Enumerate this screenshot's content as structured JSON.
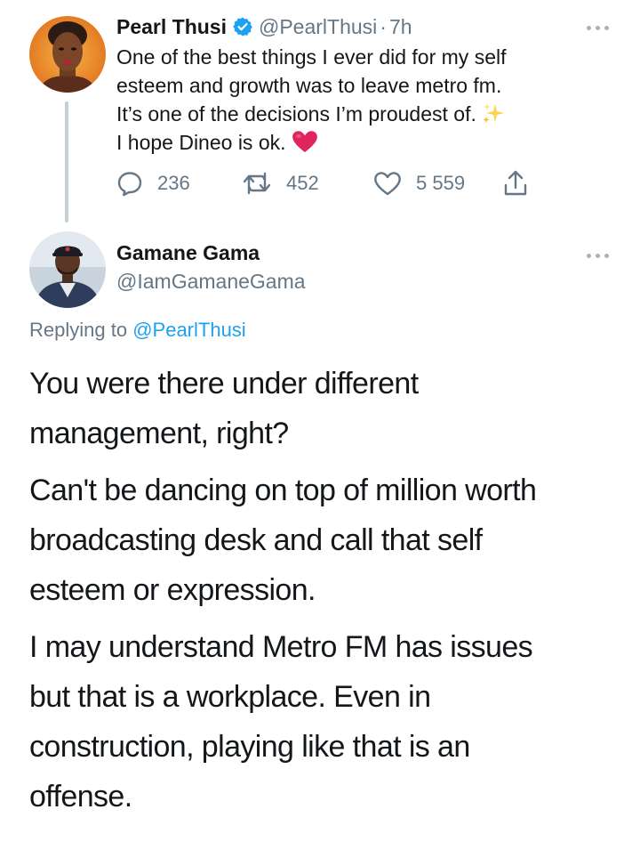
{
  "original_tweet": {
    "author_name": "Pearl Thusi",
    "author_handle": "@PearlThusi",
    "separator": "·",
    "time": "7h",
    "text_lines": [
      "One of the best things I ever did for my self",
      "esteem and growth was to leave metro fm.",
      "It’s one of the decisions I’m proudest of.",
      "I hope Dineo is ok."
    ],
    "emojis": [
      "sparkles-emoji",
      "red-heart-emoji"
    ],
    "reply_count": "236",
    "retweet_count": "452",
    "like_count": "5 559"
  },
  "reply_tweet": {
    "author_name": "Gamane Gama",
    "author_handle": "@IamGamaneGama",
    "replying_label": "Replying to",
    "replying_to": "@PearlThusi",
    "paragraphs": [
      [
        "You were there under different",
        "management, right?"
      ],
      [
        "Can't be dancing on top of million worth",
        "broadcasting desk and call that self",
        "esteem or expression."
      ],
      [
        "I may understand Metro FM has issues",
        "but that is a workplace. Even in",
        "construction, playing like that is an",
        "offense."
      ]
    ]
  },
  "colors": {
    "text": "#14171a",
    "secondary": "#657786",
    "link": "#1da1f2",
    "thread_line": "#c4cfd6",
    "heart": "#e0245e"
  },
  "icons": [
    "verified-badge-icon",
    "more-options-icon",
    "reply-icon",
    "retweet-icon",
    "like-icon",
    "share-icon"
  ]
}
